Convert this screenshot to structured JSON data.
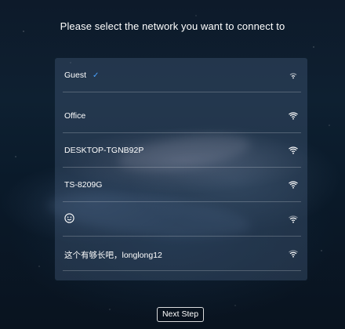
{
  "header": {
    "title": "Please select the network you want to connect to"
  },
  "networks": [
    {
      "name": "Guest",
      "selected": true,
      "check_icon": "checkmark-icon",
      "signal_icon": "wifi-weak-icon"
    },
    {
      "name": "Office",
      "selected": false,
      "signal_icon": "wifi-strong-icon"
    },
    {
      "name": "DESKTOP-TGNB92P",
      "selected": false,
      "signal_icon": "wifi-strong-icon"
    },
    {
      "name": "TS-8209G",
      "selected": false,
      "signal_icon": "wifi-strong-icon"
    },
    {
      "name": "",
      "emoji_icon": "smiley-icon",
      "selected": false,
      "signal_icon": "wifi-medium-icon"
    },
    {
      "name": "这个有够长吧，longlong12",
      "selected": false,
      "signal_icon": "wifi-medium-icon"
    }
  ],
  "footer": {
    "next_label": "Next Step"
  },
  "colors": {
    "check_accent": "#4aa3ff",
    "panel": "#465f7d",
    "text": "#ffffff"
  }
}
